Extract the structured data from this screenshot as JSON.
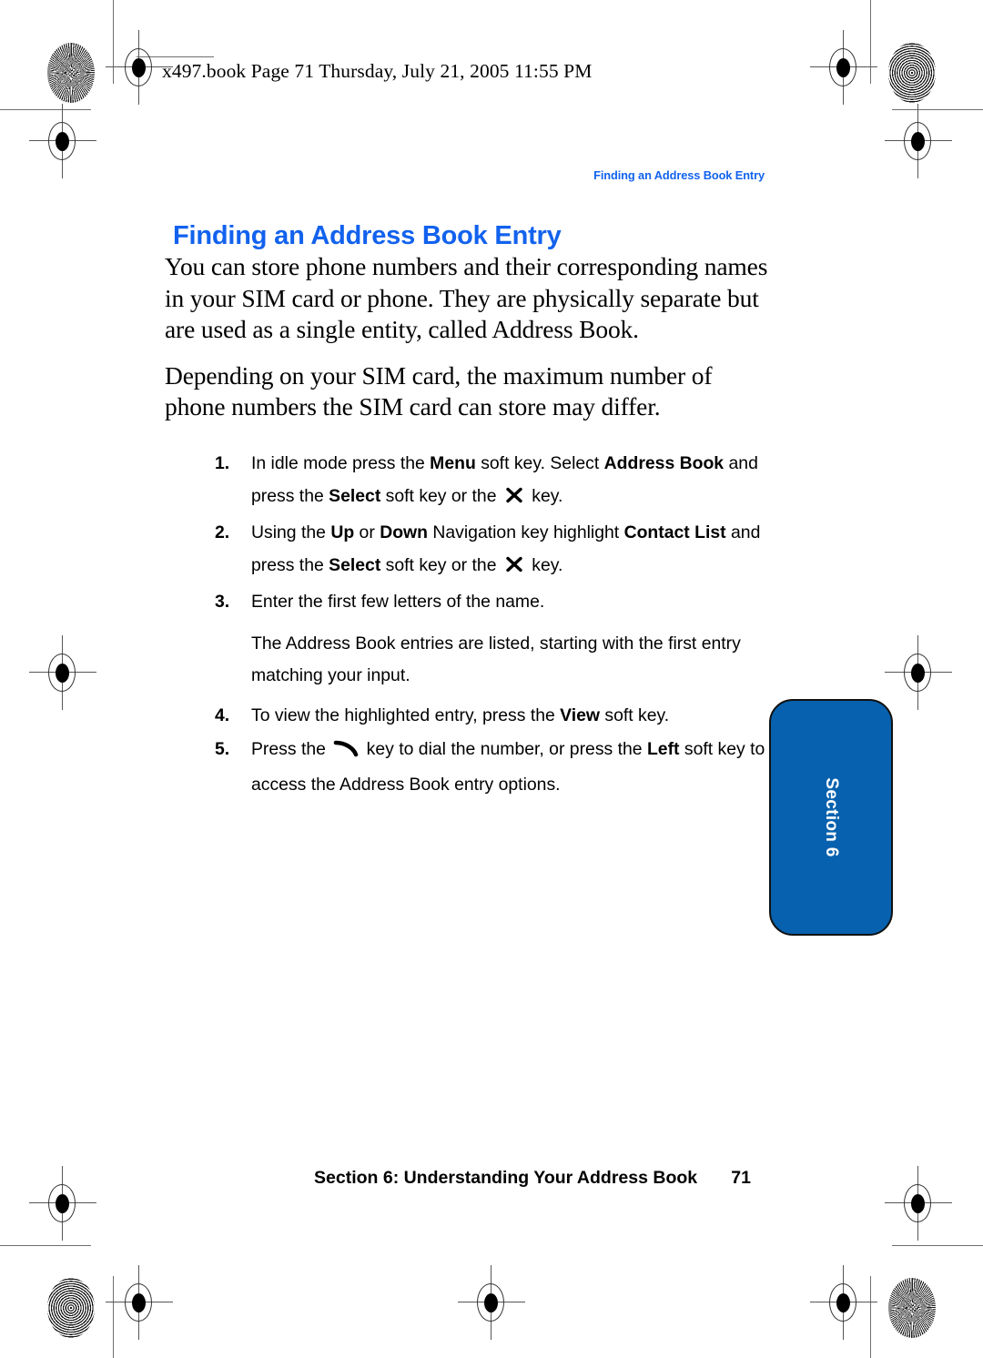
{
  "header": {
    "slug": "x497.book  Page 71  Thursday, July 21, 2005  11:55 PM"
  },
  "running_head": "Finding an Address Book Entry",
  "title": "Finding an Address Book Entry",
  "colors": {
    "title_blue": "#1262ee",
    "tab_blue": "#0761ae",
    "text_black": "#000000"
  },
  "body": {
    "paragraph_1": "You can store phone numbers and their corresponding names in your SIM card or phone. They are physically separate but are used as a single entity, called Address Book.",
    "paragraph_2": "Depending on your SIM card, the maximum number of phone numbers the SIM card can store may differ."
  },
  "steps": [
    {
      "number": "1.",
      "parts": [
        {
          "text": "In idle mode press the ",
          "bold": false
        },
        {
          "text": "Menu",
          "bold": true
        },
        {
          "text": " soft key. Select ",
          "bold": false
        },
        {
          "text": "Address Book",
          "bold": true
        },
        {
          "text": " and press the ",
          "bold": false
        },
        {
          "text": "Select",
          "bold": true
        },
        {
          "text": " soft key or the ",
          "bold": false
        },
        {
          "icon": "ok-key-icon"
        },
        {
          "text": " key.",
          "bold": false
        }
      ]
    },
    {
      "number": "2.",
      "parts": [
        {
          "text": "Using the ",
          "bold": false
        },
        {
          "text": "Up",
          "bold": true
        },
        {
          "text": " or ",
          "bold": false
        },
        {
          "text": "Down",
          "bold": true
        },
        {
          "text": " Navigation key highlight ",
          "bold": false
        },
        {
          "text": "Contact List",
          "bold": true
        },
        {
          "text": " and press the ",
          "bold": false
        },
        {
          "text": "Select",
          "bold": true
        },
        {
          "text": " soft key or the ",
          "bold": false
        },
        {
          "icon": "ok-key-icon"
        },
        {
          "text": " key.",
          "bold": false
        }
      ]
    },
    {
      "number": "3.",
      "parts": [
        {
          "text": "Enter the first few letters of the name.",
          "bold": false
        }
      ],
      "note": "The Address Book entries are listed, starting with the first entry matching your input."
    },
    {
      "number": "4.",
      "parts": [
        {
          "text": "To view the highlighted entry, press the ",
          "bold": false
        },
        {
          "text": "View",
          "bold": true
        },
        {
          "text": " soft key.",
          "bold": false
        }
      ]
    },
    {
      "number": "5.",
      "parts": [
        {
          "text": "Press the ",
          "bold": false
        },
        {
          "icon": "send-key-icon"
        },
        {
          "text": " key to dial the number, or press the ",
          "bold": false
        },
        {
          "text": "Left",
          "bold": true
        },
        {
          "text": " soft key to access the Address Book entry options.",
          "bold": false
        }
      ]
    }
  ],
  "section_tab": {
    "label": "Section 6"
  },
  "footer": {
    "text": "Section 6: Understanding Your Address Book",
    "page_number": "71"
  }
}
